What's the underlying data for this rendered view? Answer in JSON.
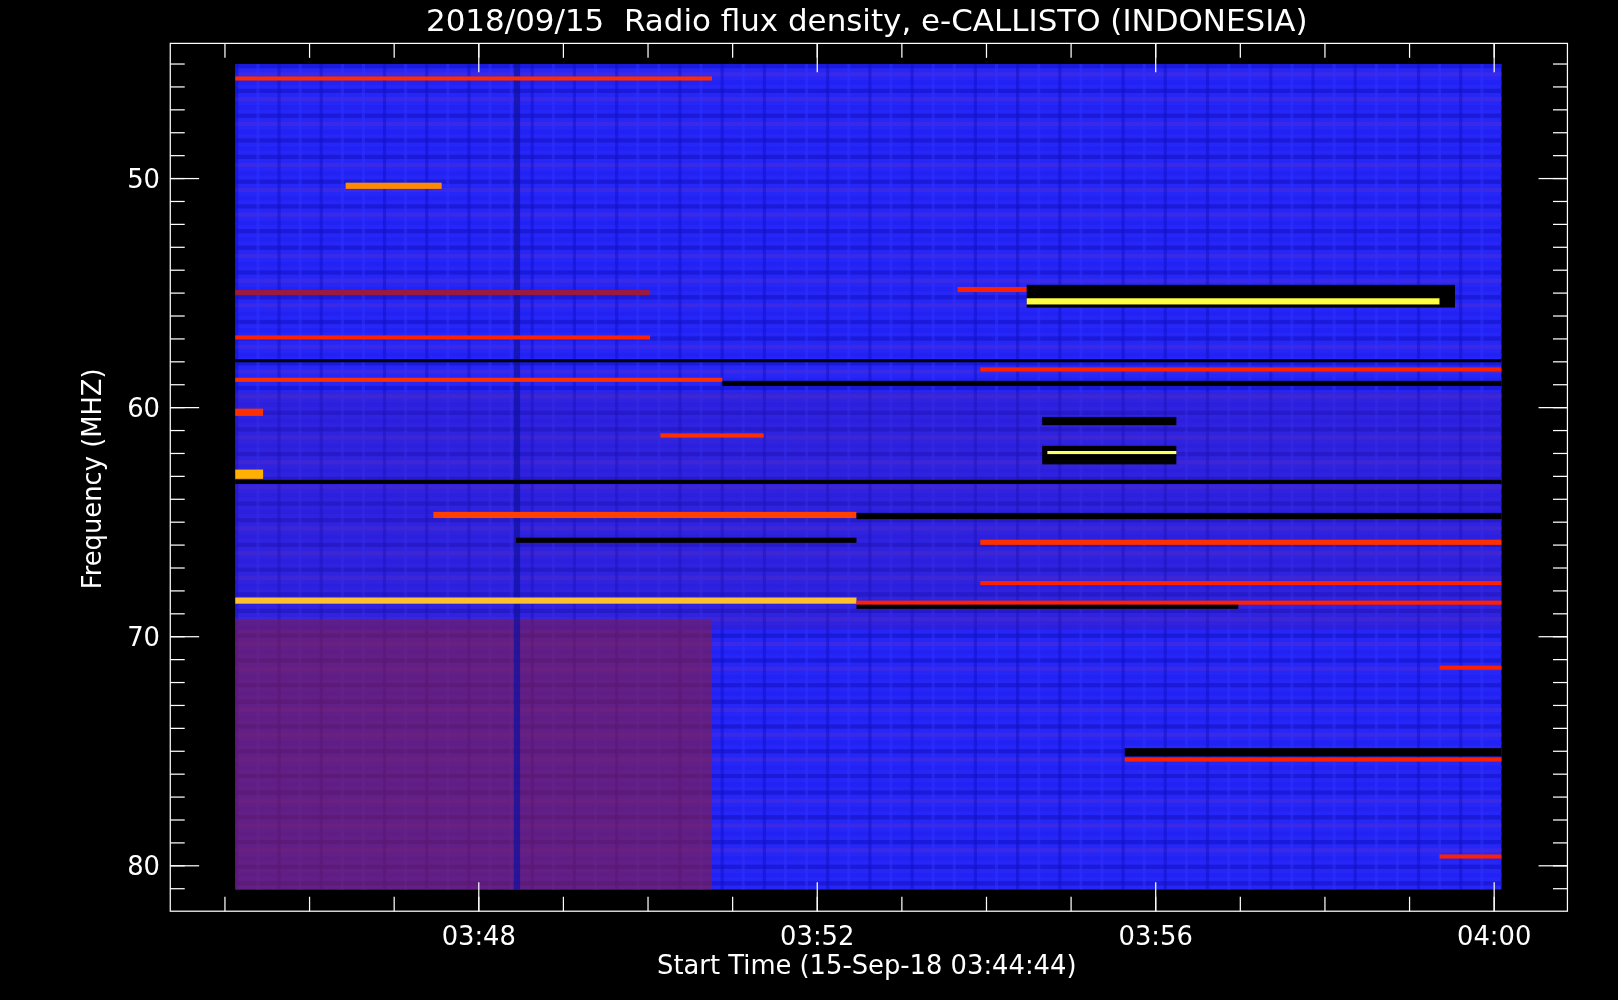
{
  "title": "2018/09/15  Radio flux density, e-CALLISTO (INDONESIA)",
  "y_axis": {
    "label": "Frequency (MHZ)",
    "ticks": [
      "50",
      "60",
      "70",
      "80"
    ]
  },
  "x_axis": {
    "label": "Start Time (15-Sep-18 03:44:44)",
    "ticks": [
      "03:48",
      "03:52",
      "03:56",
      "04:00"
    ]
  }
}
